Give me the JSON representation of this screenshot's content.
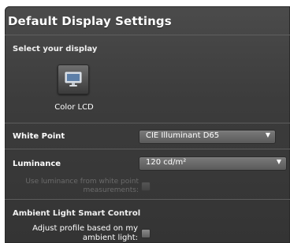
{
  "title": "Default Display Settings",
  "select_display": {
    "label": "Select your display",
    "display_name": "Color LCD",
    "icon": "monitor-icon"
  },
  "white_point": {
    "label": "White Point",
    "value": "CIE Illuminant D65"
  },
  "luminance": {
    "label": "Luminance",
    "value": "120 cd/m²",
    "use_from_white_point_line1": "Use luminance from white point",
    "use_from_white_point_line2": "measurements:",
    "use_from_white_point_checked": false
  },
  "ambient": {
    "heading": "Ambient Light Smart Control",
    "adjust_line1": "Adjust profile based on my",
    "adjust_line2": "ambient light:",
    "adjust_checked": false
  }
}
